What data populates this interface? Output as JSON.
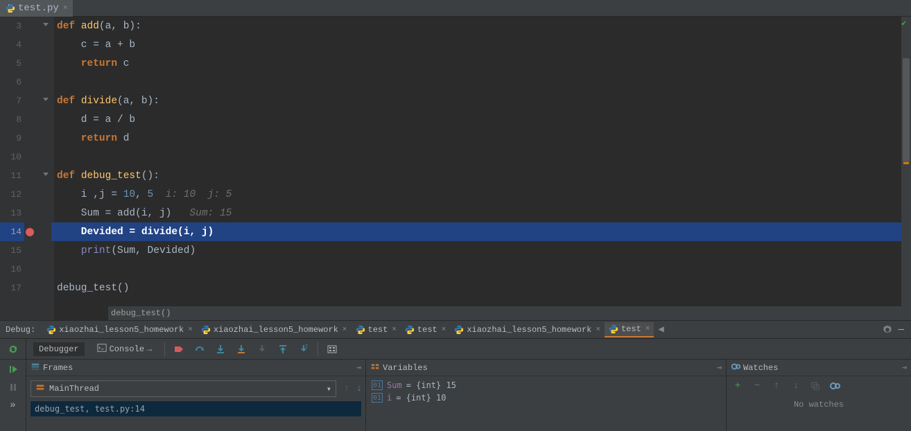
{
  "editor": {
    "tab_label": "test.py",
    "lines": [
      {
        "n": "3"
      },
      {
        "n": "4"
      },
      {
        "n": "5"
      },
      {
        "n": "6"
      },
      {
        "n": "7"
      },
      {
        "n": "8"
      },
      {
        "n": "9"
      },
      {
        "n": "10"
      },
      {
        "n": "11"
      },
      {
        "n": "12"
      },
      {
        "n": "13"
      },
      {
        "n": "14"
      },
      {
        "n": "15"
      },
      {
        "n": "16"
      },
      {
        "n": "17"
      }
    ],
    "code": {
      "l3_def": "def ",
      "l3_fn": "add",
      "l3_params": "(a, b):",
      "l4": "    c = a + b",
      "l5_ret": "    return ",
      "l5_v": "c",
      "l7_def": "def ",
      "l7_fn": "divide",
      "l7_params": "(a, b):",
      "l8": "    d = a / b",
      "l9_ret": "    return ",
      "l9_v": "d",
      "l11_def": "def ",
      "l11_fn": "debug_test",
      "l11_params": "():",
      "l12_a": "    i ,j = ",
      "l12_n1": "10",
      "l12_c": ", ",
      "l12_n2": "5",
      "l12_hint": "  i: 10  j: 5",
      "l13_a": "    Sum = add(i, j)",
      "l13_hint": "   Sum: 15",
      "l14": "    Devided = divide(i, j)",
      "l15_a": "    ",
      "l15_print": "print",
      "l15_b": "(Sum, Devided)",
      "l17": "debug_test()"
    },
    "breadcrumb": "debug_test()"
  },
  "debug": {
    "label": "Debug:",
    "tabs": [
      "xiaozhai_lesson5_homework",
      "xiaozhai_lesson5_homework",
      "test",
      "test",
      "xiaozhai_lesson5_homework",
      "test"
    ],
    "subtabs": {
      "debugger": "Debugger",
      "console": "Console"
    },
    "frames": {
      "title": "Frames",
      "thread": "MainThread",
      "item": "debug_test, test.py:14"
    },
    "variables": {
      "title": "Variables",
      "rows": [
        {
          "name": "Sum",
          "val": "= {int} 15"
        },
        {
          "name": "i",
          "val": "= {int} 10"
        }
      ]
    },
    "watches": {
      "title": "Watches",
      "empty": "No watches"
    }
  }
}
